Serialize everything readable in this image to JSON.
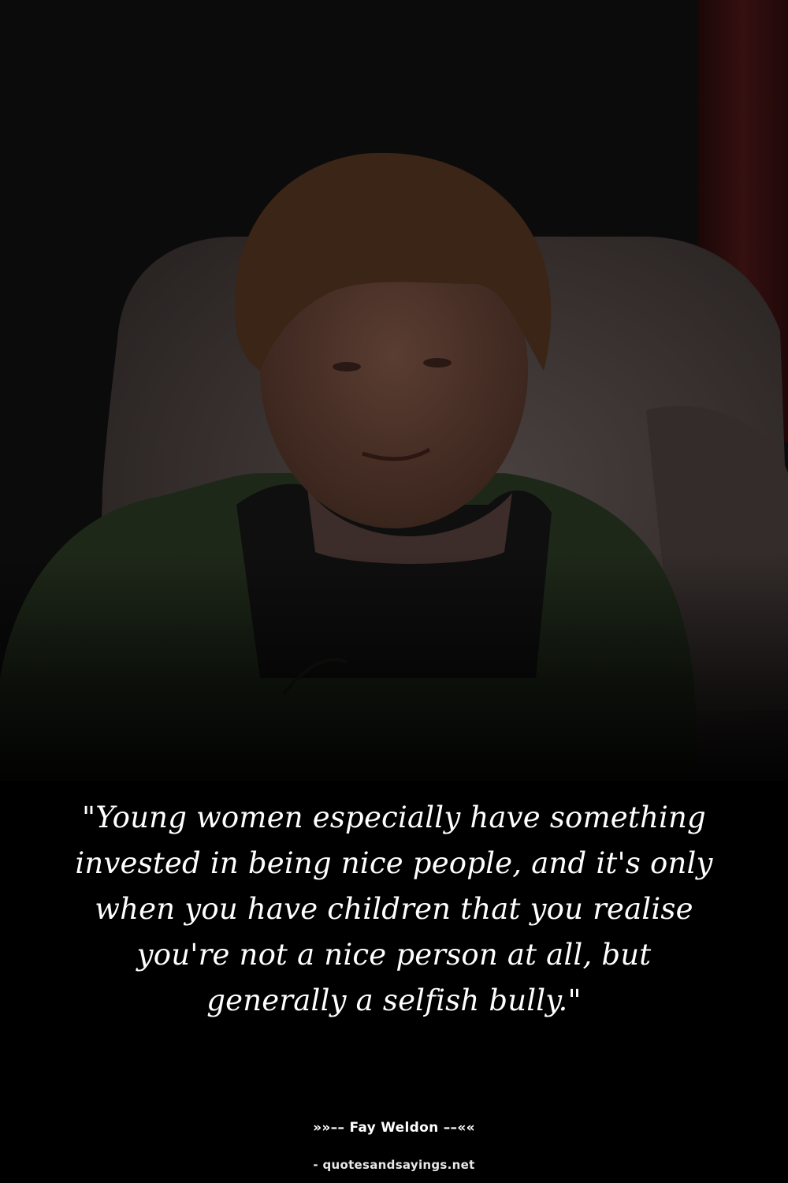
{
  "image": {
    "subject": "portrait-photo",
    "colors": {
      "background": "#0c0c0c",
      "chair": "#3b3433",
      "cardigan": "#1f2a1a",
      "hair": "#3a2416",
      "skin": "#4a3128",
      "curtain": "#2a0c0c"
    }
  },
  "quote": {
    "text": "\"Young women especially have something invested in being nice people, and it's only when you have children that you realise you're not a nice person at all, but generally a selfish bully.\""
  },
  "attribution": {
    "text": "»»–– Fay Weldon ––««"
  },
  "source": {
    "text": "- quotesandsayings.net"
  }
}
